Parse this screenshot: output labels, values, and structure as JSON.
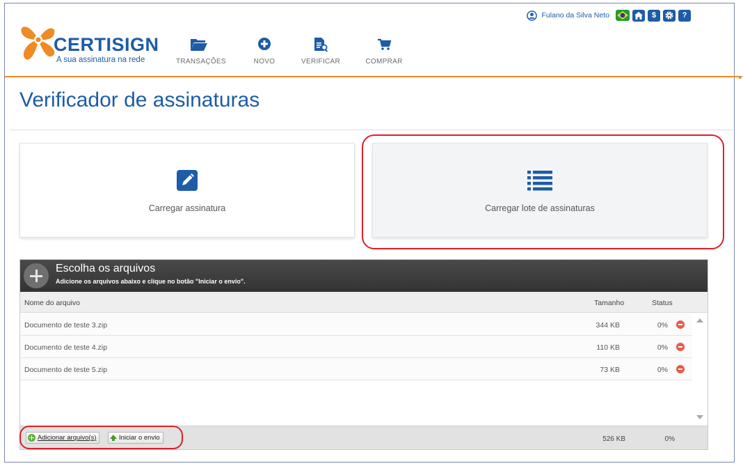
{
  "brand": {
    "name": "CERTISIGN",
    "tagline": "A sua assinatura na rede",
    "primary_color": "#1d5ca6",
    "accent_color": "#f08a24"
  },
  "user_bar": {
    "user_name": "Fulano da Silva Neto",
    "user_icon": "user-circle-icon",
    "buttons": [
      {
        "icon": "brazil-flag-icon"
      },
      {
        "icon": "home-icon"
      },
      {
        "icon": "dollar-icon",
        "glyph": "$"
      },
      {
        "icon": "gear-icon"
      },
      {
        "icon": "help-icon",
        "glyph": "?"
      }
    ]
  },
  "nav": [
    {
      "label": "TRANSAÇÕES",
      "icon": "folder-open-icon"
    },
    {
      "label": "NOVO",
      "icon": "plus-circle-icon"
    },
    {
      "label": "VERIFICAR",
      "icon": "document-search-icon"
    },
    {
      "label": "COMPRAR",
      "icon": "cart-icon"
    }
  ],
  "page": {
    "title": "Verificador de assinaturas"
  },
  "cards": [
    {
      "label": "Carregar assinatura",
      "icon": "edit-icon"
    },
    {
      "label": "Carregar lote de assinaturas",
      "icon": "list-icon",
      "selected": true
    }
  ],
  "uploader": {
    "title": "Escolha os arquivos",
    "subtitle": "Adicione os arquivos abaixo e clique no botão \"Iniciar o envio\".",
    "columns": {
      "name": "Nome do arquivo",
      "size": "Tamanho",
      "status": "Status"
    },
    "files": [
      {
        "name": "Documento de teste 3.zip",
        "size": "344 KB",
        "status": "0%"
      },
      {
        "name": "Documento de teste 4.zip",
        "size": "110 KB",
        "status": "0%"
      },
      {
        "name": "Documento de teste 5.zip",
        "size": "73 KB",
        "status": "0%"
      }
    ],
    "footer": {
      "add_label": "Adicionar arquivo(s)",
      "start_label": "Iniciar o envio",
      "total_size": "526 KB",
      "total_status": "0%"
    }
  },
  "highlight_color": "#e01e25"
}
